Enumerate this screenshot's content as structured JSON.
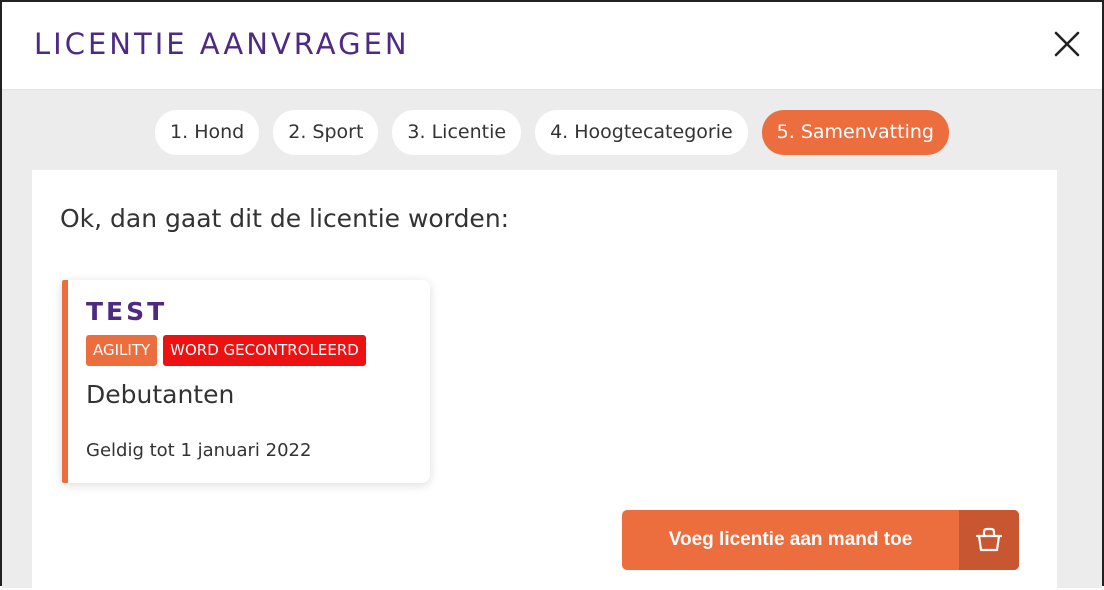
{
  "dialog": {
    "title": "LICENTIE AANVRAGEN",
    "close_icon": "close-icon"
  },
  "steps": [
    {
      "label": "1. Hond",
      "active": false
    },
    {
      "label": "2. Sport",
      "active": false
    },
    {
      "label": "3. Licentie",
      "active": false
    },
    {
      "label": "4. Hoogtecategorie",
      "active": false
    },
    {
      "label": "5. Samenvatting",
      "active": true
    }
  ],
  "summary": {
    "intro": "Ok, dan gaat dit de licentie worden:",
    "card": {
      "name": "TEST",
      "sport_badge": "AGILITY",
      "status_badge": "WORD GECONTROLEERD",
      "category": "Debutanten",
      "valid_until": "Geldig tot 1 januari 2022"
    }
  },
  "cart_button": {
    "label": "Voeg licentie aan mand toe",
    "icon": "basket-icon"
  },
  "colors": {
    "brand_purple": "#4e2a83",
    "accent_orange": "#ec6e3f",
    "accent_orange_dark": "#c85631",
    "status_red": "#ee1111",
    "backdrop_gray": "#ececec"
  }
}
